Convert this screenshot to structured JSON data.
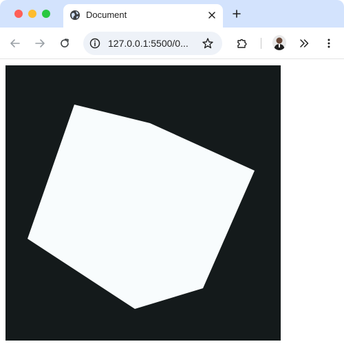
{
  "browser": {
    "tab": {
      "title": "Document",
      "favicon": "globe-icon",
      "close_icon": "close-icon"
    },
    "new_tab_icon": "plus-icon",
    "toolbar": {
      "back_icon": "back-arrow-icon",
      "forward_icon": "forward-arrow-icon",
      "reload_icon": "reload-icon",
      "address": "127.0.0.1:5500/0...",
      "site_info_icon": "info-icon",
      "bookmark_icon": "star-icon",
      "extensions_icon": "puzzle-icon",
      "overflow_icon": "chevron-double-right-icon",
      "menu_icon": "kebab-menu-icon"
    }
  },
  "page": {
    "canvas_background": "#141a1b",
    "shape_fill": "#f8fcfd"
  }
}
